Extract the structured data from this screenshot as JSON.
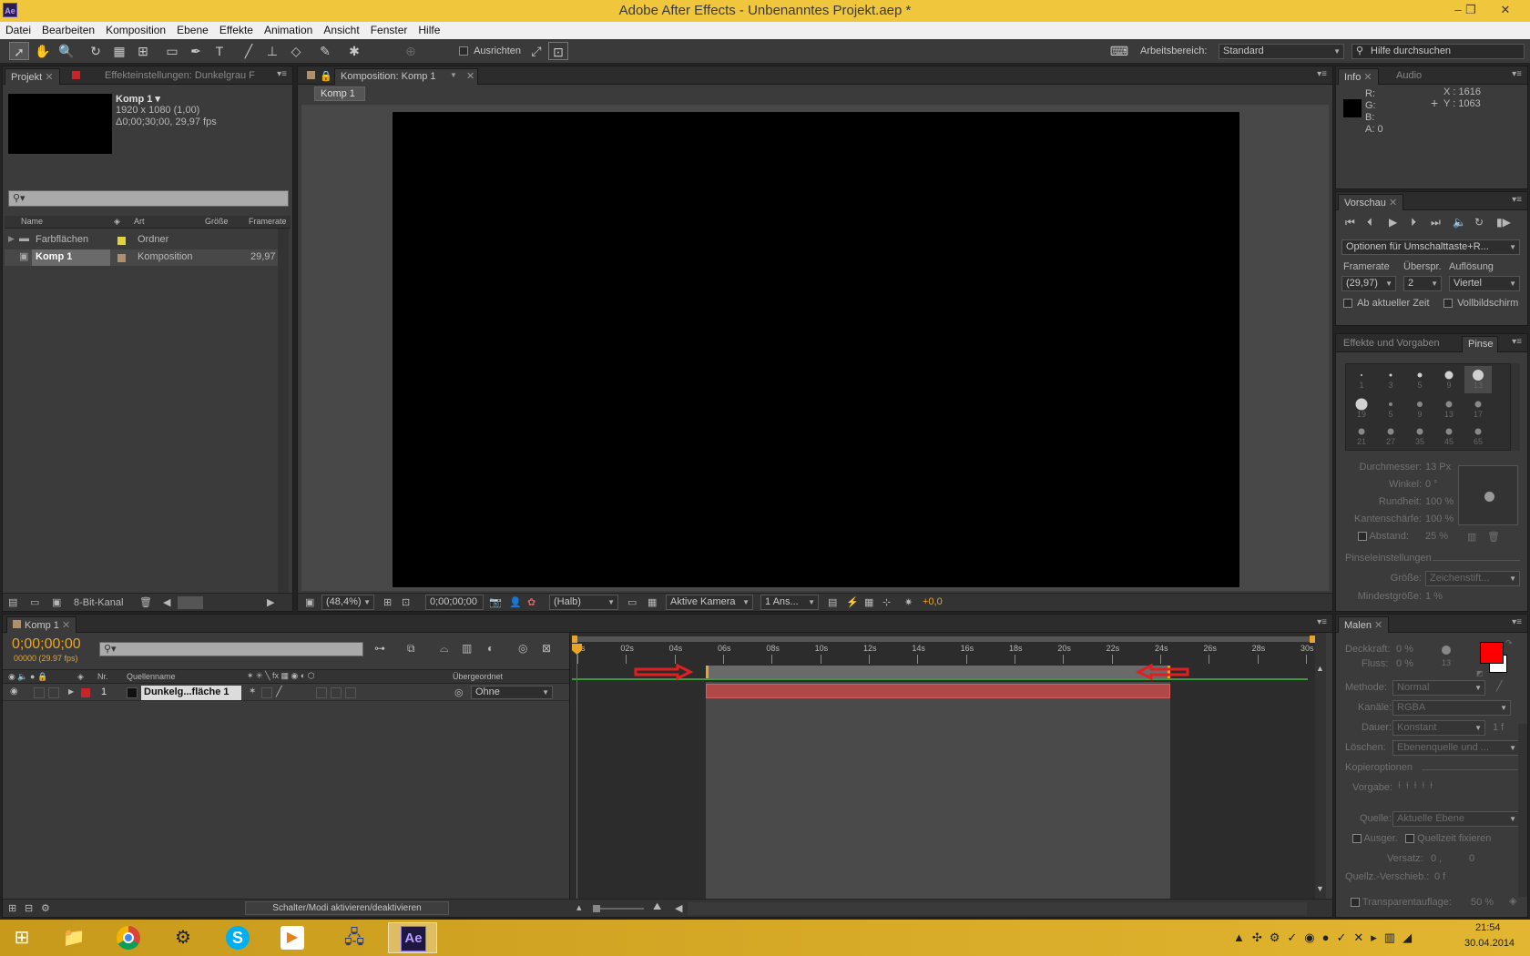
{
  "app": {
    "title": "Adobe After Effects - Unbenanntes Projekt.aep *",
    "icon_label": "Ae"
  },
  "menu": [
    "Datei",
    "Bearbeiten",
    "Komposition",
    "Ebene",
    "Effekte",
    "Animation",
    "Ansicht",
    "Fenster",
    "Hilfe"
  ],
  "toolbar": {
    "align_label": "Ausrichten",
    "workspace_label": "Arbeitsbereich:",
    "workspace_value": "Standard",
    "help_placeholder": "Hilfe durchsuchen"
  },
  "project_panel": {
    "tab_project": "Projekt",
    "tab_effects": "Effekteinstellungen: Dunkelgrau F",
    "comp_name": "Komp 1 ▾",
    "comp_size": "1920 x 1080 (1,00)",
    "comp_duration": "Δ0;00;30;00, 29,97 fps",
    "columns": [
      "Name",
      "Art",
      "Größe",
      "Framerate"
    ],
    "rows": [
      {
        "name": "Farbflächen",
        "type": "Ordner",
        "size": "",
        "framerate": ""
      },
      {
        "name": "Komp 1",
        "type": "Komposition",
        "size": "",
        "framerate": "29,97"
      }
    ],
    "bit_depth": "8-Bit-Kanal"
  },
  "composition_panel": {
    "tab": "Komposition: Komp 1",
    "breadcrumb": "Komp 1",
    "zoom": "(48,4%)",
    "timecode": "0;00;00;00",
    "resolution": "(Halb)",
    "camera": "Aktive Kamera",
    "views": "1 Ans...",
    "exposure": "+0,0"
  },
  "info_panel": {
    "tab_info": "Info",
    "tab_audio": "Audio",
    "r": "R:",
    "g": "G:",
    "b": "B:",
    "a": "A:  0",
    "x": "X : 1616",
    "y": "Y : 1063"
  },
  "preview_panel": {
    "tab": "Vorschau",
    "options": "Optionen für Umschalttaste+R...",
    "framerate_label": "Framerate",
    "skip_label": "Überspr.",
    "resolution_label": "Auflösung",
    "framerate_value": "(29,97)",
    "skip_value": "2",
    "resolution_value": "Viertel",
    "from_current": "Ab aktueller Zeit",
    "fullscreen": "Vollbildschirm"
  },
  "brushes_panel": {
    "tab_effects": "Effekte und Vorgaben",
    "tab_brushes": "Pinse",
    "brush_sizes": [
      "1",
      "3",
      "5",
      "9",
      "13",
      "19",
      "5",
      "9",
      "13",
      "17",
      "21",
      "27",
      "35",
      "45",
      "65"
    ],
    "diameter_label": "Durchmesser:",
    "diameter_value": "13 Px",
    "angle_label": "Winkel:",
    "angle_value": "0 °",
    "roundness_label": "Rundheit:",
    "roundness_value": "100 %",
    "hardness_label": "Kantenschärfe:",
    "hardness_value": "100 %",
    "spacing_label": "Abstand:",
    "spacing_value": "25 %",
    "brush_settings": "Pinseleinstellungen",
    "size_label": "Größe:",
    "size_value": "Zeichenstift...",
    "min_size_label": "Mindestgröße:",
    "min_size_value": "1 %"
  },
  "timeline_panel": {
    "tab": "Komp 1",
    "timecode": "0;00;00;00",
    "frames": "00000 (29.97 fps)",
    "col_nr": "Nr.",
    "col_source": "Quellenname",
    "col_parent": "Übergeordnet",
    "layer_nr": "1",
    "layer_name": "Dunkelg...fläche 1",
    "layer_parent": "Ohne",
    "toggle_label": "Schalter/Modi aktivieren/deaktivieren",
    "ruler": [
      "00s",
      "02s",
      "04s",
      "06s",
      "08s",
      "10s",
      "12s",
      "14s",
      "16s",
      "18s",
      "20s",
      "22s",
      "24s",
      "26s",
      "28s",
      "30s"
    ],
    "work_area_start": 5.3,
    "work_area_end": 24.4,
    "layer_start": 5.3,
    "layer_end": 24.4,
    "duration": 30
  },
  "paint_panel": {
    "tab": "Malen",
    "opacity_label": "Deckkraft:",
    "opacity_value": "0 %",
    "flow_label": "Fluss:",
    "flow_value": "0 %",
    "brush_num": "13",
    "method_label": "Methode:",
    "method_value": "Normal",
    "channels_label": "Kanäle:",
    "channels_value": "RGBA",
    "duration_label": "Dauer:",
    "duration_value": "Konstant",
    "duration_f": "1 f",
    "erase_label": "Löschen:",
    "erase_value": "Ebenenquelle und ...",
    "clone_options": "Kopieroptionen",
    "preset_label": "Vorgabe:",
    "source_label": "Quelle:",
    "source_value": "Aktuelle Ebene",
    "aligned": "Ausger.",
    "lock_time": "Quellzeit fixieren",
    "offset_label": "Versatz:",
    "offset_x": "0 ,",
    "offset_y": "0",
    "source_time_label": "Quellz.-Verschieb.:",
    "source_time_value": "0 f",
    "overlay_label": "Transparentauflage:",
    "overlay_value": "50 %",
    "fg_color": "#ff0000",
    "bg_color": "#ffffff"
  },
  "taskbar": {
    "time": "21:54",
    "date": "30.04.2014",
    "ae_label": "Ae"
  }
}
